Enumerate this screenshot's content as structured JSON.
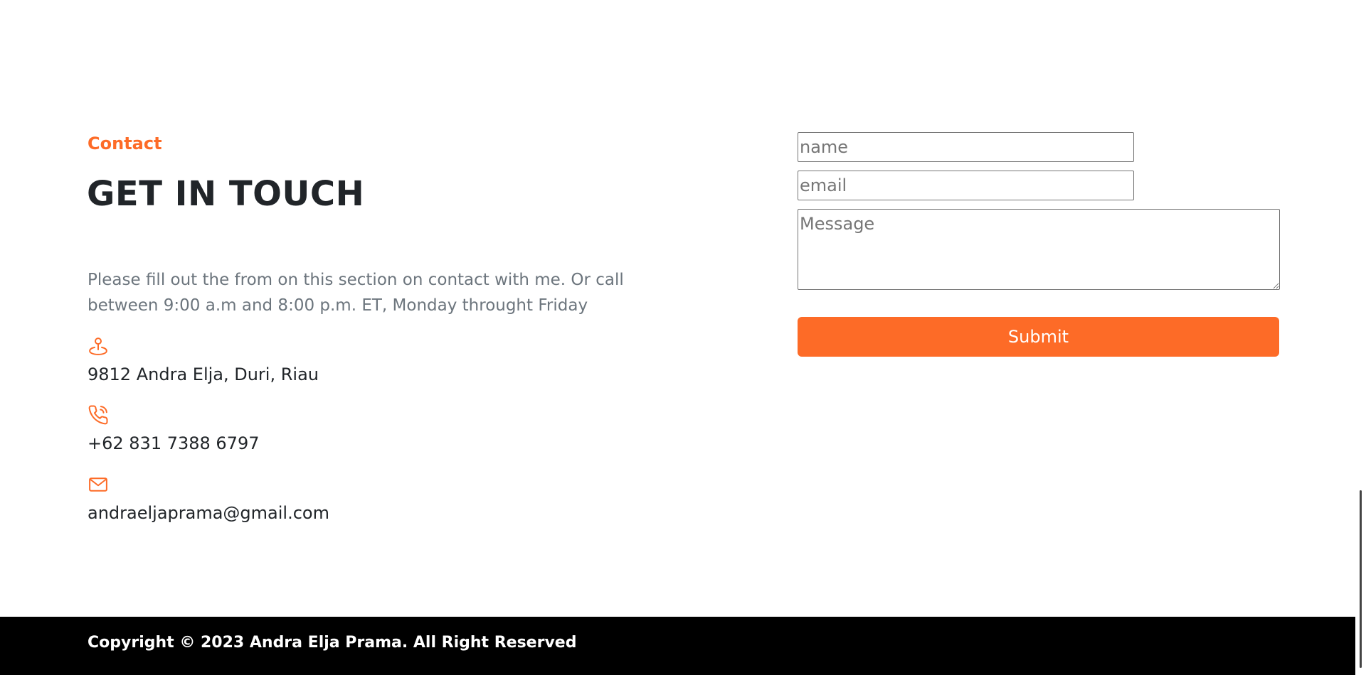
{
  "contact": {
    "eyebrow": "Contact",
    "heading": "GET IN TOUCH",
    "description": "Please fill out the from on this section on contact with me. Or call between 9:00 a.m and 8:00 p.m. ET, Monday throught Friday",
    "address": "9812 Andra Elja, Duri, Riau",
    "phone": "+62 831 7388 6797",
    "email": "andraeljaprama@gmail.com",
    "accent_color": "#fd6b27",
    "icons": [
      "location-pin-icon",
      "phone-icon",
      "mail-icon"
    ]
  },
  "form": {
    "name_placeholder": "name",
    "email_placeholder": "email",
    "message_placeholder": "Message",
    "submit_label": "Submit"
  },
  "footer": {
    "copyright": "Copyright © 2023 Andra Elja Prama. All Right Reserved"
  }
}
